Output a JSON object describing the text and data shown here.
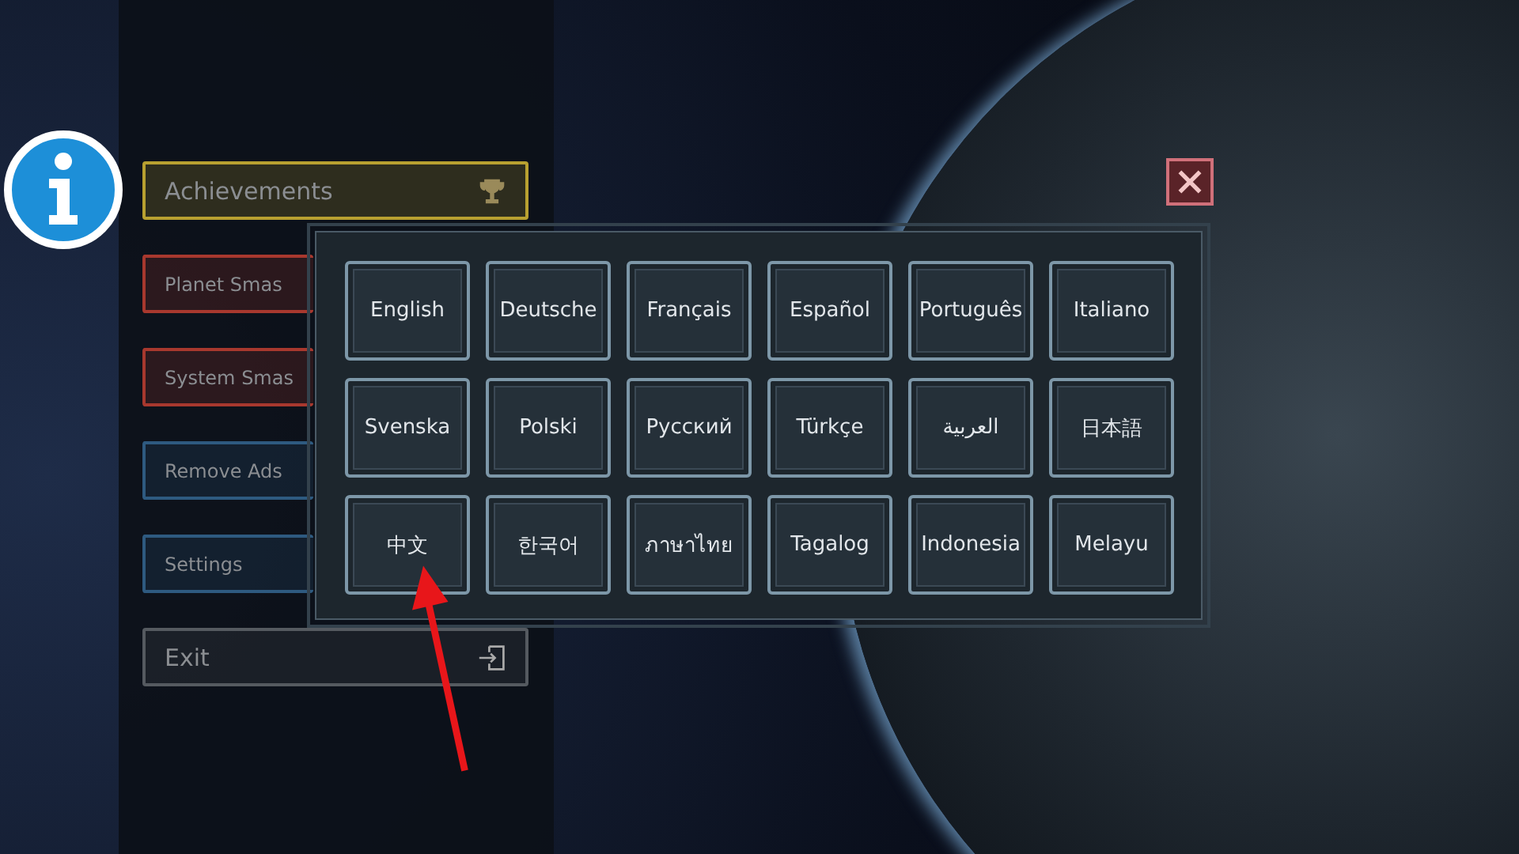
{
  "menu": [
    {
      "label": "Achievements",
      "color": "#b8a030",
      "kind": "trophy",
      "covered": false
    },
    {
      "label": "Planet Smas",
      "color": "#a8382e",
      "kind": "plain",
      "covered": true
    },
    {
      "label": "System Smas",
      "color": "#a8382e",
      "kind": "plain",
      "covered": true
    },
    {
      "label": "Remove Ads",
      "color": "#2e5a80",
      "kind": "plain",
      "covered": true
    },
    {
      "label": "Settings",
      "color": "#2e5a80",
      "kind": "plain",
      "covered": true
    },
    {
      "label": "Exit",
      "color": "#555a60",
      "kind": "exit",
      "covered": false
    }
  ],
  "language_dialog": {
    "languages": [
      [
        "English",
        "Deutsche",
        "Français",
        "Español",
        "Português",
        "Italiano"
      ],
      [
        "Svenska",
        "Polski",
        "Русский",
        "Türkçe",
        "العربية",
        "日本語"
      ],
      [
        "中文",
        "한국어",
        "ภาษาไทย",
        "Tagalog",
        "Indonesia",
        "Melayu"
      ]
    ]
  }
}
